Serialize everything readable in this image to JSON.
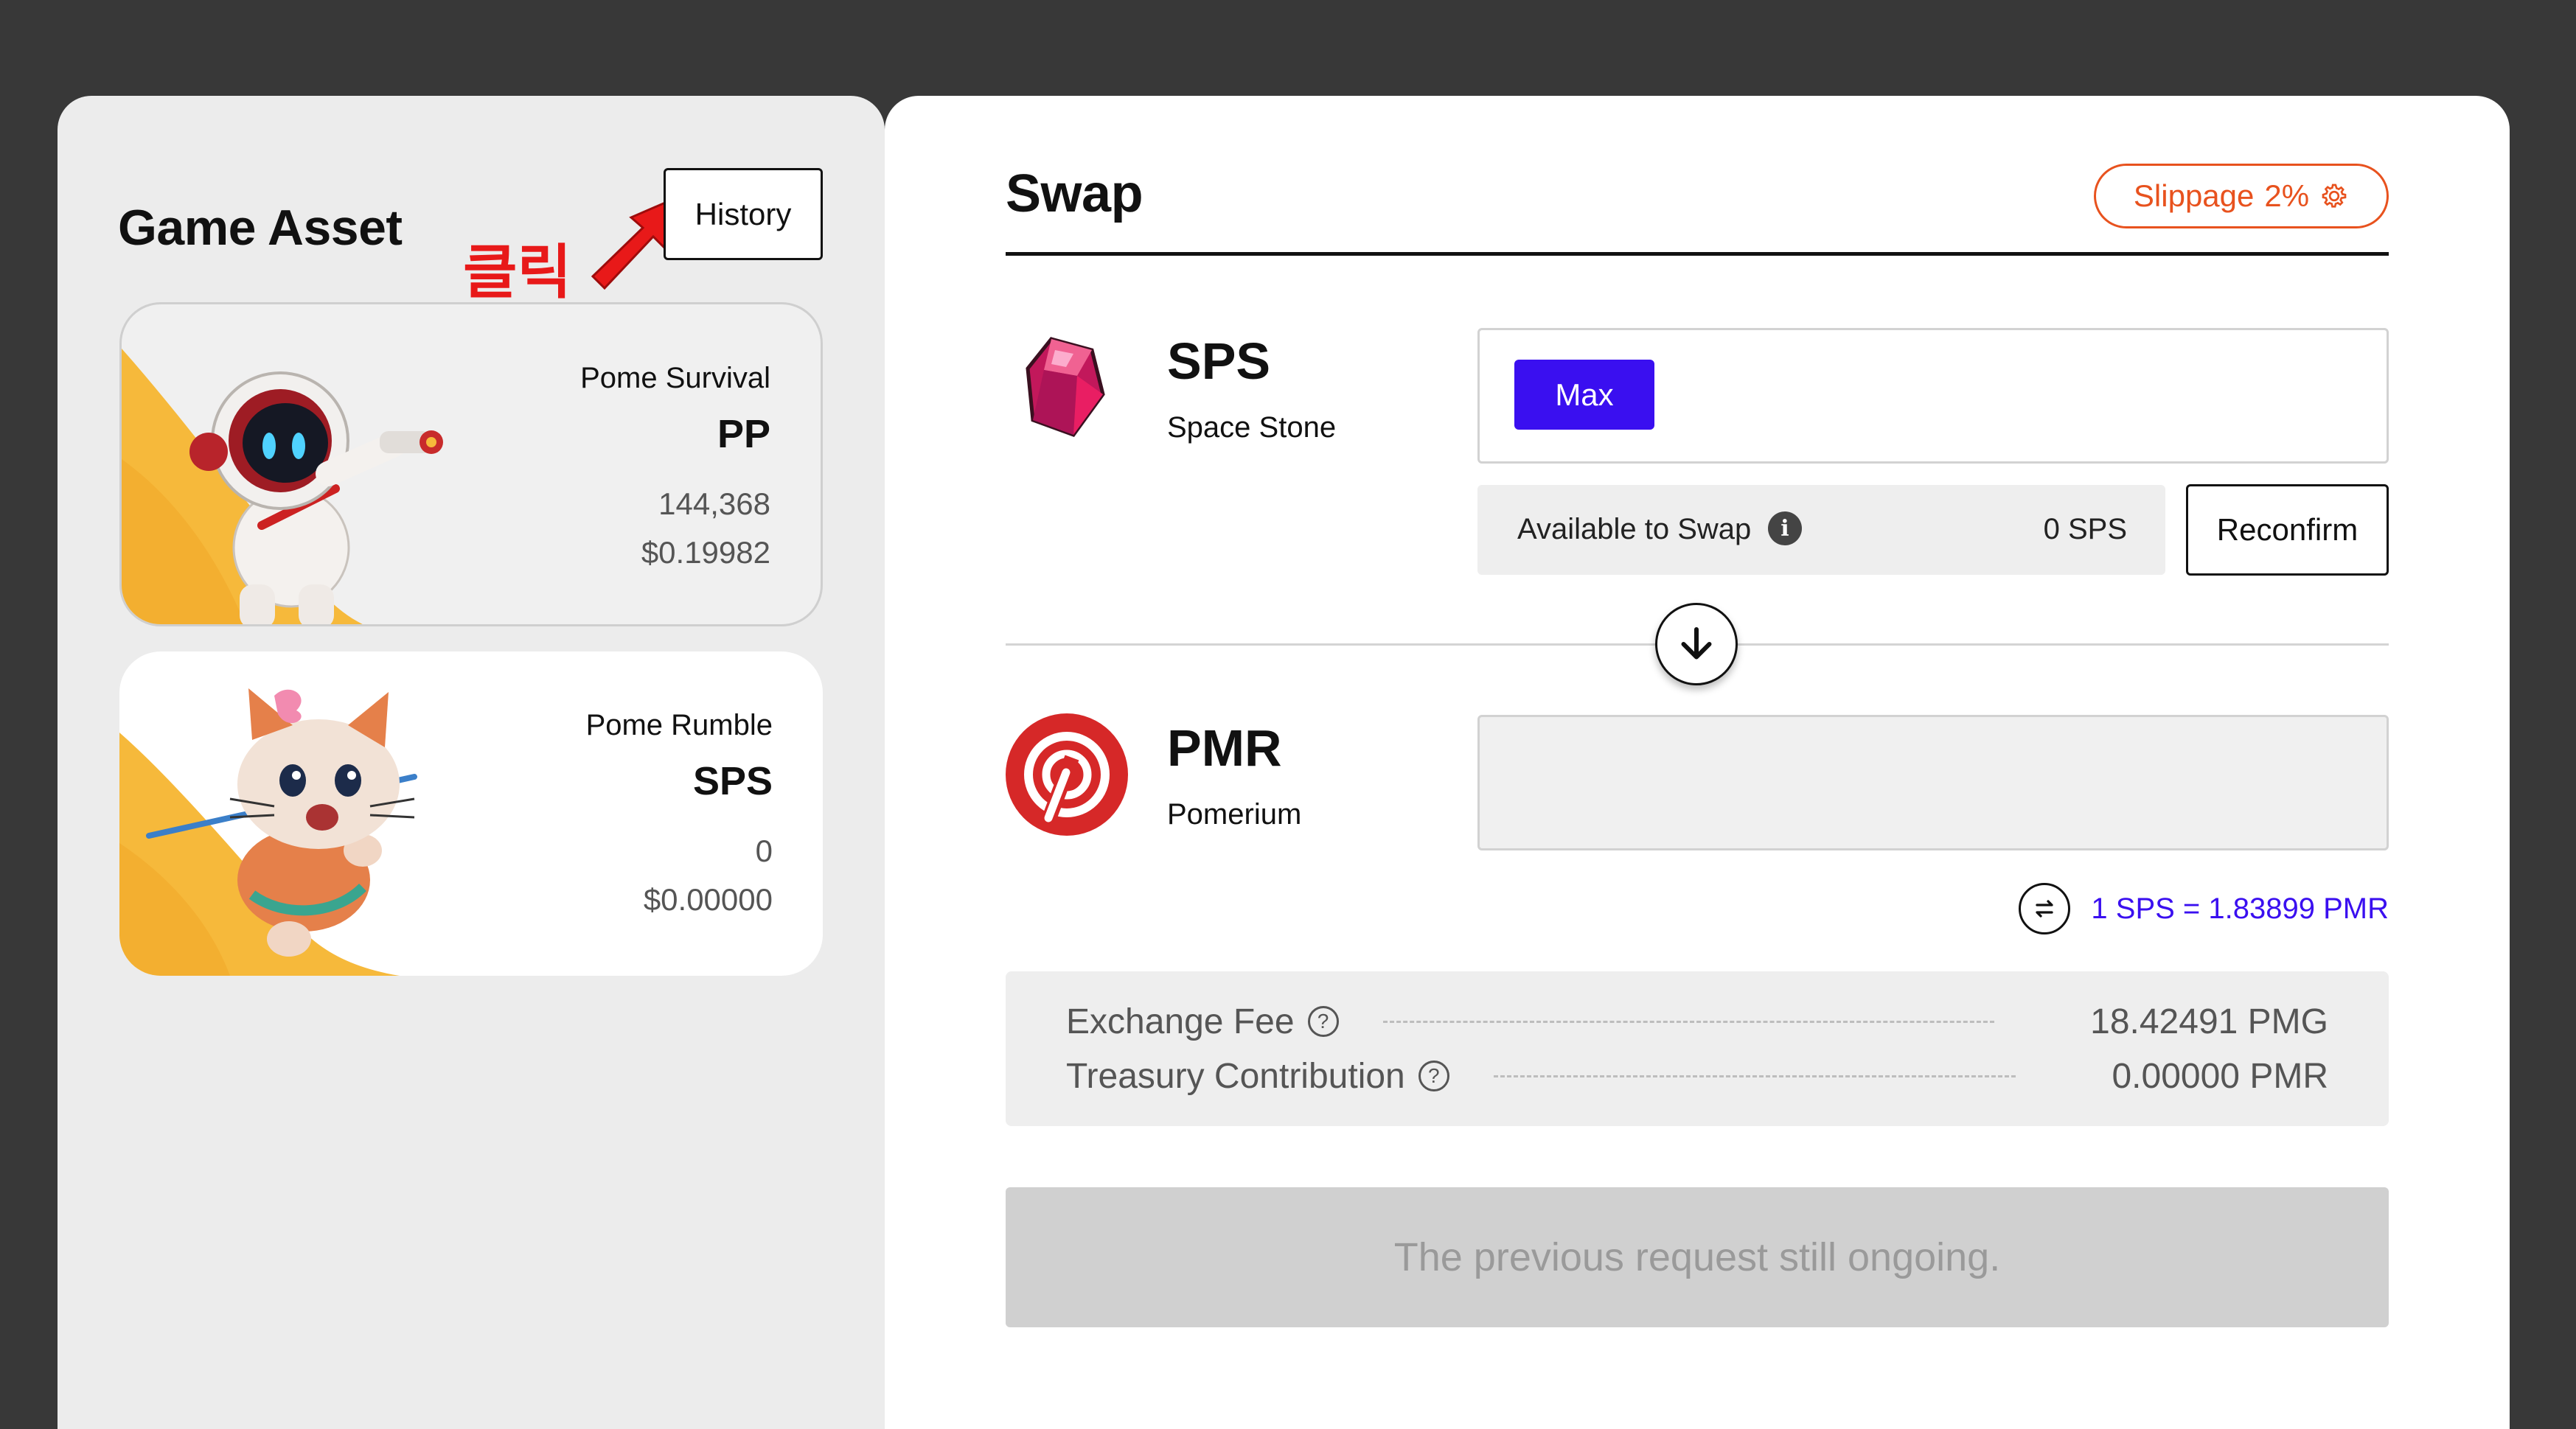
{
  "game_asset": {
    "title": "Game Asset",
    "history_label": "History",
    "annotation_label": "클릭",
    "cards": [
      {
        "game": "Pome Survival",
        "token": "PP",
        "amount": "144,368",
        "usd": "$0.19982"
      },
      {
        "game": "Pome Rumble",
        "token": "SPS",
        "amount": "0",
        "usd": "$0.00000"
      }
    ]
  },
  "swap": {
    "title": "Swap",
    "slippage_label": "Slippage",
    "slippage_value": "2%",
    "from": {
      "symbol": "SPS",
      "name": "Space Stone",
      "max_label": "Max",
      "value": ""
    },
    "available_label": "Available to Swap",
    "available_value": "0 SPS",
    "reconfirm_label": "Reconfirm",
    "to": {
      "symbol": "PMR",
      "name": "Pomerium",
      "value": ""
    },
    "rate": "1 SPS = 1.83899 PMR",
    "fees": [
      {
        "label": "Exchange Fee",
        "value": "18.42491 PMG"
      },
      {
        "label": "Treasury Contribution",
        "value": "0.00000 PMR"
      }
    ],
    "submit_label": "The previous request still ongoing."
  },
  "colors": {
    "accent": "#3a0ff0",
    "slippage": "#e8521e",
    "annotation": "#e81919",
    "pmr_brand": "#d62828",
    "sps_brand": "#d4367a"
  },
  "icons": [
    "gear-icon",
    "info-icon",
    "arrow-down-icon",
    "swap-arrows-icon",
    "help-icon",
    "red-arrow-icon"
  ]
}
